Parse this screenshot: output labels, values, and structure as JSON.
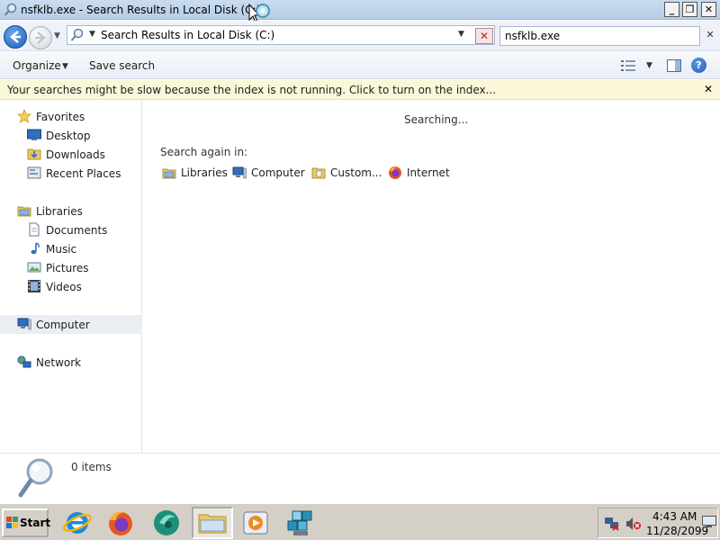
{
  "window": {
    "title": "nsfklb.exe - Search Results in Local Disk (C:)",
    "minimize_label": "_",
    "maximize_label": "❐",
    "close_label": "✕"
  },
  "address": {
    "path": "Search Results in Local Disk (C:)",
    "stop_label": "✕"
  },
  "search": {
    "query": "nsfklb.exe",
    "clear_label": "✕"
  },
  "toolbar": {
    "organize_label": "Organize",
    "save_search_label": "Save search",
    "help_label": "?"
  },
  "infobar": {
    "message": "Your searches might be slow because the index is not running.  Click to turn on the index...",
    "close_label": "✕"
  },
  "sidebar": {
    "favorites": "Favorites",
    "desktop": "Desktop",
    "downloads": "Downloads",
    "recent_places": "Recent Places",
    "libraries": "Libraries",
    "documents": "Documents",
    "music": "Music",
    "pictures": "Pictures",
    "videos": "Videos",
    "computer": "Computer",
    "network": "Network",
    "selected": "Computer"
  },
  "content": {
    "status": "Searching...",
    "search_again_label": "Search again in:",
    "search_again_items": [
      "Libraries",
      "Computer",
      "Custom...",
      "Internet"
    ]
  },
  "details": {
    "item_count": "0 items"
  },
  "taskbar": {
    "start_label": "Start",
    "clock_time": "4:43 AM",
    "clock_date": "11/28/2099",
    "active_item": "windows-explorer"
  },
  "colors": {
    "titlebar": "#b7cde6",
    "infobar": "#fbf8d9",
    "selection": "#e9eef4",
    "taskbar": "#d4d0c8"
  }
}
